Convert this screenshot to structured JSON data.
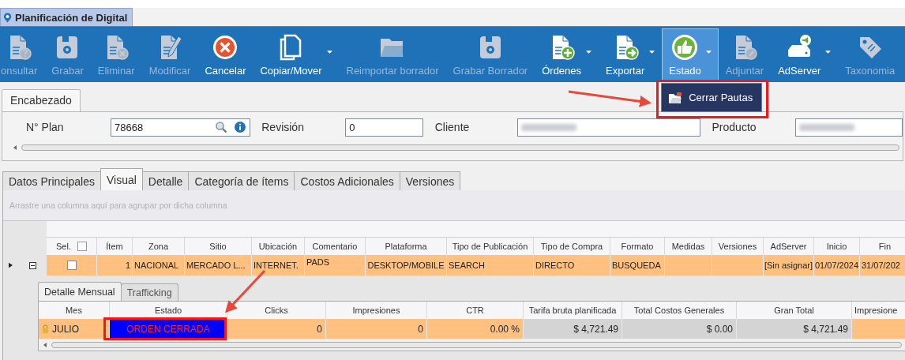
{
  "window": {
    "title": "Planificación de Digital"
  },
  "toolbar": [
    {
      "label": "onsultar",
      "disabled": true,
      "dropdown": false,
      "selected": false,
      "expanded": false
    },
    {
      "label": "Grabar",
      "disabled": true,
      "dropdown": false,
      "selected": false,
      "expanded": false
    },
    {
      "label": "Eliminar",
      "disabled": true,
      "dropdown": false,
      "selected": false,
      "expanded": false
    },
    {
      "label": "Modificar",
      "disabled": true,
      "dropdown": false,
      "selected": false,
      "expanded": false
    },
    {
      "label": "Cancelar",
      "disabled": false,
      "dropdown": false,
      "selected": false,
      "expanded": false
    },
    {
      "label": "Copiar/Mover",
      "disabled": false,
      "dropdown": true,
      "selected": false,
      "expanded": false
    },
    {
      "label": "Reimportar borrador",
      "disabled": true,
      "dropdown": false,
      "selected": false,
      "expanded": false
    },
    {
      "label": "Grabar Borrador",
      "disabled": true,
      "dropdown": false,
      "selected": false,
      "expanded": false
    },
    {
      "label": "Órdenes",
      "disabled": false,
      "dropdown": true,
      "selected": false,
      "expanded": false
    },
    {
      "label": "Exportar",
      "disabled": false,
      "dropdown": true,
      "selected": false,
      "expanded": false
    },
    {
      "label": "Estado",
      "disabled": false,
      "dropdown": true,
      "selected": true,
      "expanded": true,
      "menu": [
        {
          "label": "Cerrar Pautas"
        }
      ]
    },
    {
      "label": "Adjuntar",
      "disabled": true,
      "dropdown": false,
      "selected": false,
      "expanded": false
    },
    {
      "label": "AdServer",
      "disabled": false,
      "dropdown": true,
      "selected": false,
      "expanded": false
    },
    {
      "label": "Taxonomia",
      "disabled": true,
      "dropdown": false,
      "selected": false,
      "expanded": false
    }
  ],
  "header": {
    "tab": "Encabezado",
    "fields": [
      {
        "label": "N° Plan",
        "value": "78668",
        "kind": "lookup"
      },
      {
        "label": "Revisión",
        "value": "0",
        "kind": "text"
      },
      {
        "label": "Cliente",
        "kind": "redacted"
      },
      {
        "label": "Producto",
        "kind": "redacted"
      }
    ]
  },
  "tabs": [
    {
      "label": "Datos Principales",
      "selected": false
    },
    {
      "label": "Visual",
      "selected": true
    },
    {
      "label": "Detalle",
      "selected": false
    },
    {
      "label": "Categoría de ítems",
      "selected": false
    },
    {
      "label": "Costos Adicionales",
      "selected": false
    },
    {
      "label": "Versiones",
      "selected": false
    }
  ],
  "grid": {
    "group_hint": "Arrastre una columna aquí para agrupar por dicha columna",
    "select_all_checked": false,
    "columns": [
      "Sel.",
      "Ítem",
      "Zona",
      "Sitio",
      "Ubicación",
      "Comentario",
      "Plataforma",
      "Tipo de Publicación",
      "Tipo de Compra",
      "Formato",
      "Medidas",
      "Versiones",
      "AdServer",
      "Inicio",
      "Fin"
    ],
    "rows": [
      {
        "current": true,
        "expanded": true,
        "checked": false,
        "cells": [
          "",
          "1",
          "NACIONAL",
          "MERCADO L...",
          "INTERNET.",
          "PADS",
          "DESKTOP/MOBILE",
          "SEARCH",
          "DIRECTO",
          "BUSQUEDA",
          "",
          "",
          "[Sin asignar]",
          "01/07/2024",
          "31/07/202"
        ]
      }
    ]
  },
  "detail": {
    "tabs": [
      {
        "label": "Detalle Mensual",
        "selected": true
      },
      {
        "label": "Trafficking",
        "selected": false
      }
    ],
    "columns": [
      "Mes",
      "Estado",
      "Clicks",
      "Impresiones",
      "CTR",
      "Tarifa bruta planificada",
      "Total Costos Generales",
      "Gran Total",
      "Impresione"
    ],
    "rows": [
      {
        "locked": true,
        "cells": [
          {
            "kind": "plain",
            "text": "JULIO",
            "color": "#ffc080"
          },
          {
            "kind": "status",
            "text": "ORDEN CERRADA",
            "color": "#0000ff"
          },
          {
            "kind": "plain",
            "text": "0",
            "color": "#ffc080"
          },
          {
            "kind": "plain",
            "text": "0",
            "color": "#ffc080"
          },
          {
            "kind": "plain",
            "text": "0.00 %",
            "color": "#ffc080"
          },
          {
            "kind": "plain",
            "text": "$ 4,721.49",
            "color": "#d4d4d4"
          },
          {
            "kind": "plain",
            "text": "$ 0.00",
            "color": "#d4d4d4"
          },
          {
            "kind": "plain",
            "text": "$ 4,721.49",
            "color": "#d4d4d4"
          },
          {
            "kind": "plain",
            "color": "#ffc080"
          }
        ]
      }
    ]
  }
}
